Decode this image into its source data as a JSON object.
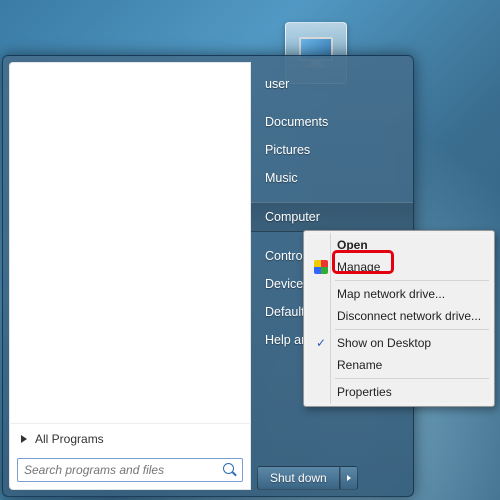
{
  "user_tile": {
    "alt": "computer-monitor-icon"
  },
  "right_panel": {
    "items": [
      {
        "label": "user"
      },
      {
        "label": "Documents"
      },
      {
        "label": "Pictures"
      },
      {
        "label": "Music"
      },
      {
        "label": "Computer",
        "highlighted": true
      },
      {
        "label": "Control Panel"
      },
      {
        "label": "Devices and Printers"
      },
      {
        "label": "Default Programs"
      },
      {
        "label": "Help and Support"
      }
    ]
  },
  "all_programs_label": "All Programs",
  "search": {
    "placeholder": "Search programs and files"
  },
  "shutdown": {
    "label": "Shut down"
  },
  "context_menu": {
    "items": [
      {
        "label": "Open",
        "bold": true
      },
      {
        "label": "Manage",
        "icon": "shield"
      },
      {
        "sep": true
      },
      {
        "label": "Map network drive..."
      },
      {
        "label": "Disconnect network drive..."
      },
      {
        "sep": true
      },
      {
        "label": "Show on Desktop",
        "icon": "check"
      },
      {
        "label": "Rename"
      },
      {
        "sep": true
      },
      {
        "label": "Properties"
      }
    ]
  },
  "callout": {
    "target": "Manage"
  }
}
